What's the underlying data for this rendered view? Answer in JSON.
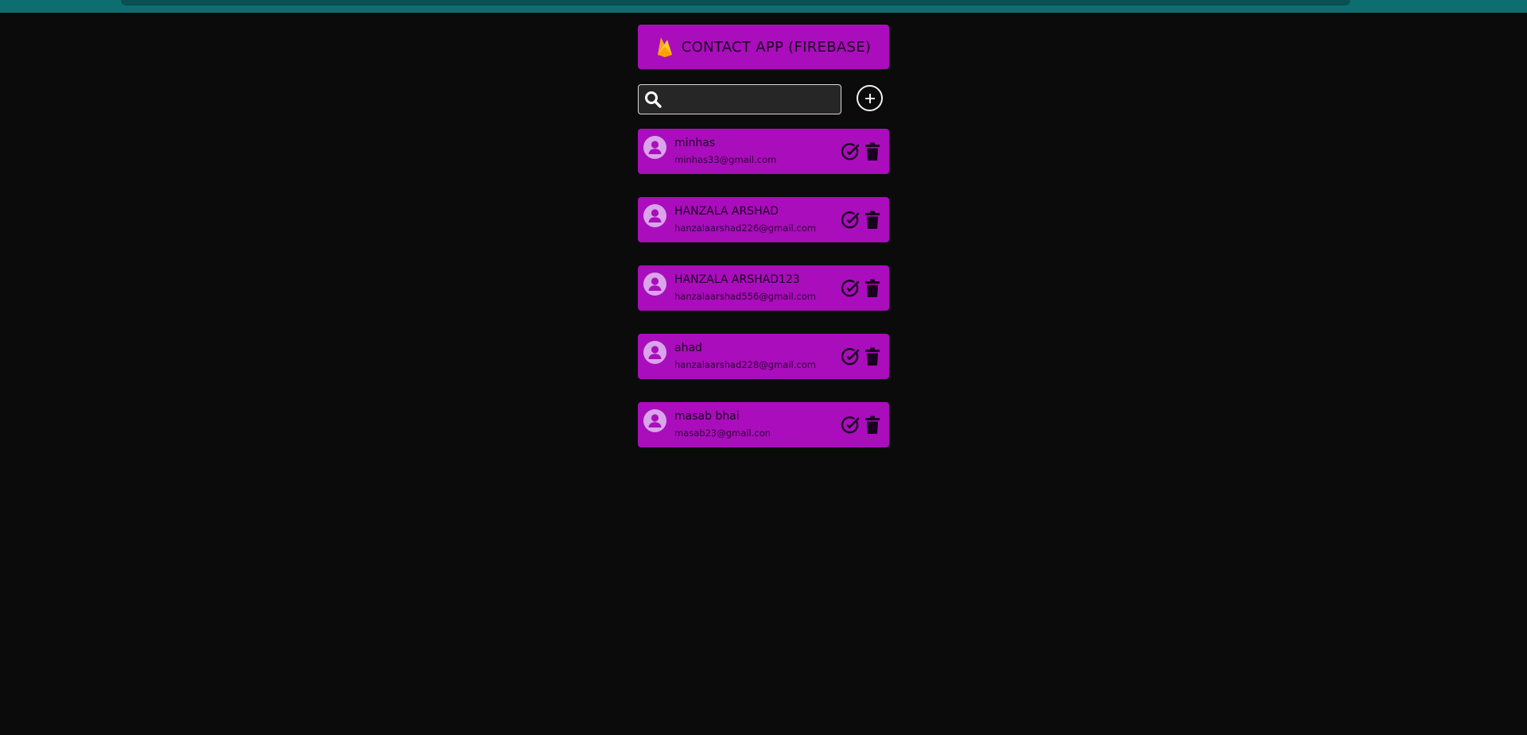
{
  "header": {
    "title": "CONTACT APP (FIREBASE)",
    "logo_icon": "firebase-flame-icon"
  },
  "search": {
    "value": "",
    "placeholder": "",
    "icon": "search-icon"
  },
  "add_button": {
    "icon": "plus-circle-icon"
  },
  "contacts": [
    {
      "name": "minhas",
      "email": "minhas33@gmail.com"
    },
    {
      "name": "HANZALA ARSHAD",
      "email": "hanzalaarshad226@gmail.com"
    },
    {
      "name": "HANZALA ARSHAD123",
      "email": "hanzalaarshad556@gmail.com"
    },
    {
      "name": "ahad",
      "email": "hanzalaarshad228@gmail.com"
    },
    {
      "name": "masab bhai",
      "email": "masab23@gmail.con"
    }
  ],
  "colors": {
    "background": "#0b0b0b",
    "accent": "#aa0dbb",
    "avatar": "#d9a4ea",
    "topbar": "#0d6e70"
  }
}
